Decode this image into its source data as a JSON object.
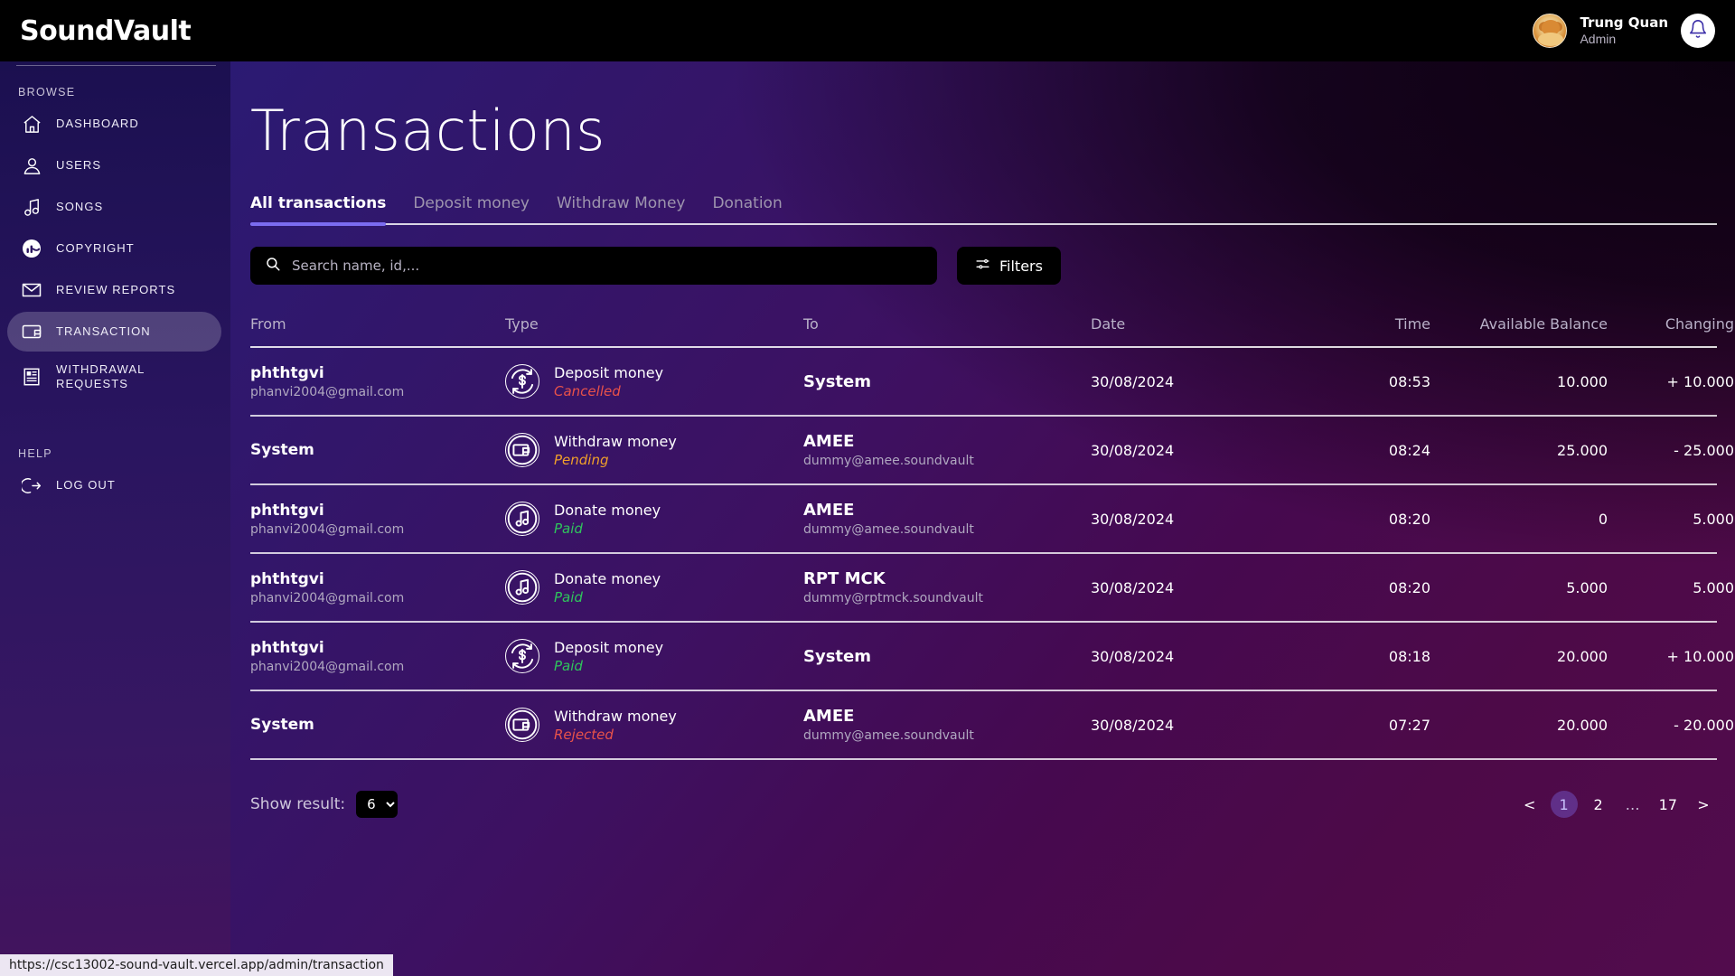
{
  "topbar": {
    "brand": "SoundVault",
    "user_name": "Trung Quan",
    "user_role": "Admin",
    "bell_icon": "bell-icon",
    "avatar_icon": "avatar"
  },
  "sidebar": {
    "section_browse": "BROWSE",
    "section_help": "HELP",
    "items": [
      {
        "label": "DASHBOARD",
        "icon": "home-icon",
        "active": false
      },
      {
        "label": "USERS",
        "icon": "user-icon",
        "active": false
      },
      {
        "label": "SONGS",
        "icon": "music-note-icon",
        "active": false
      },
      {
        "label": "COPYRIGHT",
        "icon": "copyright-icon",
        "active": false
      },
      {
        "label": "REVIEW REPORTS",
        "icon": "envelope-icon",
        "active": false
      },
      {
        "label": "TRANSACTION",
        "icon": "wallet-icon",
        "active": true
      },
      {
        "label": "WITHDRAWAL\nREQUESTS",
        "icon": "document-icon",
        "active": false
      }
    ],
    "help_items": [
      {
        "label": "LOG OUT",
        "icon": "logout-icon"
      }
    ]
  },
  "page": {
    "title": "Transactions"
  },
  "tabs": [
    {
      "label": "All transactions",
      "active": true
    },
    {
      "label": "Deposit money",
      "active": false
    },
    {
      "label": "Withdraw Money",
      "active": false
    },
    {
      "label": "Donation",
      "active": false
    }
  ],
  "search": {
    "placeholder": "Search name, id,...",
    "value": "",
    "icon": "search-icon"
  },
  "filters": {
    "label": "Filters",
    "icon": "filter-sliders-icon"
  },
  "table": {
    "headers": [
      "From",
      "Type",
      "To",
      "Date",
      "Time",
      "Available Balance",
      "Changing"
    ],
    "rows": [
      {
        "from_name": "phthtgvi",
        "from_sub": "phanvi2004@gmail.com",
        "type_label": "Deposit money",
        "type_status": "Cancelled",
        "type_status_color": "#e8524a",
        "type_icon": "deposit-money-icon",
        "to_name": "System",
        "to_sub": "",
        "date": "30/08/2024",
        "time": "08:53",
        "balance": "10.000",
        "changing": "+ 10.000"
      },
      {
        "from_name": "System",
        "from_sub": "",
        "type_label": "Withdraw money",
        "type_status": "Pending",
        "type_status_color": "#f0a02a",
        "type_icon": "withdraw-money-icon",
        "to_name": "AMEE",
        "to_sub": "dummy@amee.soundvault",
        "date": "30/08/2024",
        "time": "08:24",
        "balance": "25.000",
        "changing": "- 25.000"
      },
      {
        "from_name": "phthtgvi",
        "from_sub": "phanvi2004@gmail.com",
        "type_label": "Donate money",
        "type_status": "Paid",
        "type_status_color": "#2fc45c",
        "type_icon": "donate-money-icon",
        "to_name": "AMEE",
        "to_sub": "dummy@amee.soundvault",
        "date": "30/08/2024",
        "time": "08:20",
        "balance": "0",
        "changing": "5.000"
      },
      {
        "from_name": "phthtgvi",
        "from_sub": "phanvi2004@gmail.com",
        "type_label": "Donate money",
        "type_status": "Paid",
        "type_status_color": "#2fc45c",
        "type_icon": "donate-money-icon",
        "to_name": "RPT MCK",
        "to_sub": "dummy@rptmck.soundvault",
        "date": "30/08/2024",
        "time": "08:20",
        "balance": "5.000",
        "changing": "5.000"
      },
      {
        "from_name": "phthtgvi",
        "from_sub": "phanvi2004@gmail.com",
        "type_label": "Deposit money",
        "type_status": "Paid",
        "type_status_color": "#2fc45c",
        "type_icon": "deposit-money-icon",
        "to_name": "System",
        "to_sub": "",
        "date": "30/08/2024",
        "time": "08:18",
        "balance": "20.000",
        "changing": "+ 10.000"
      },
      {
        "from_name": "System",
        "from_sub": "",
        "type_label": "Withdraw money",
        "type_status": "Rejected",
        "type_status_color": "#e8524a",
        "type_icon": "withdraw-money-icon",
        "to_name": "AMEE",
        "to_sub": "dummy@amee.soundvault",
        "date": "30/08/2024",
        "time": "07:27",
        "balance": "20.000",
        "changing": "- 20.000"
      }
    ]
  },
  "footer": {
    "show_result_label": "Show result:",
    "show_result_value": "6",
    "show_result_options": [
      "6"
    ],
    "pagination": {
      "prev": "<",
      "next": ">",
      "pages": [
        "1",
        "2",
        "…",
        "17"
      ],
      "current": "1"
    }
  },
  "statusbar": {
    "url": "https://csc13002-sound-vault.vercel.app/admin/transaction"
  },
  "colors": {
    "accent": "#7b6cf0",
    "paid": "#2fc45c",
    "pending": "#f0a02a",
    "failed": "#e8524a"
  }
}
